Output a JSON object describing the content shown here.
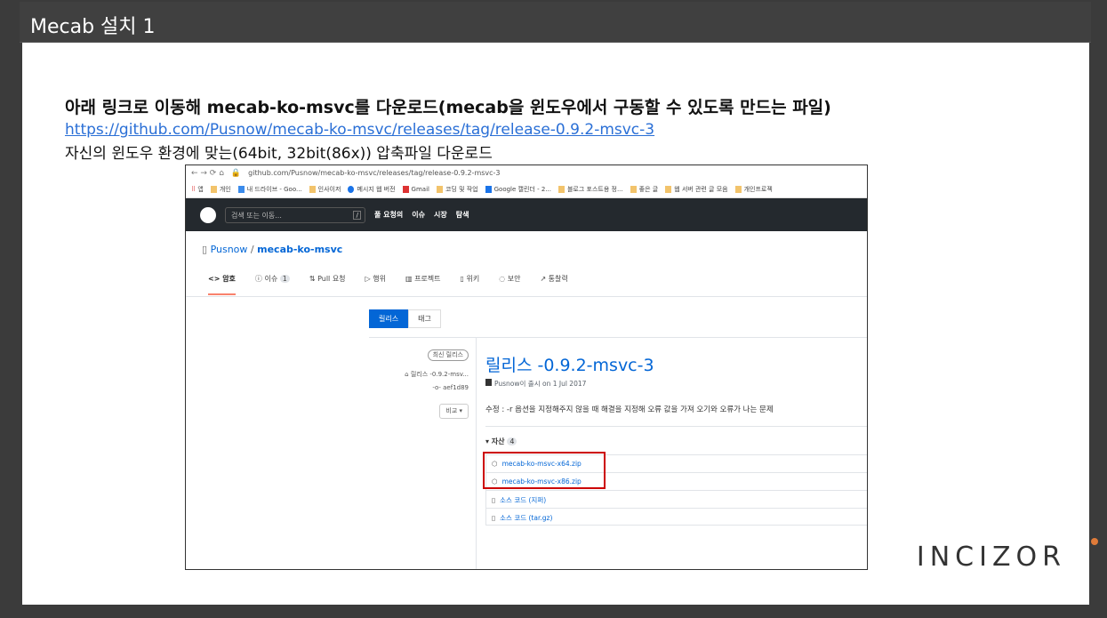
{
  "slide": {
    "title": "Mecab 설치 1",
    "heading": "아래 링크로 이동해 mecab-ko-msvc를 다운로드(mecab을 윈도우에서 구동할 수 있도록 만드는 파일)",
    "link": "https://github.com/Pusnow/mecab-ko-msvc/releases/tag/release-0.9.2-msvc-3",
    "instruction": "자신의 윈도우 환경에 맞는(64bit, 32bit(86x)) 압축파일 다운로드",
    "logo": "INCIZOR"
  },
  "browser": {
    "url": "github.com/Pusnow/mecab-ko-msvc/releases/tag/release-0.9.2-msvc-3",
    "bookmarks": [
      "앱",
      "개인",
      "내 드라이브 - Goo...",
      "인사이저",
      "메시지 웹 버전",
      "Gmail",
      "코딩 및 작업",
      "Google 캘린더 - 2...",
      "블로그 포스트용 정...",
      "좋은 글",
      "웹 서버 관련 글 모음",
      "개인프로젝"
    ]
  },
  "github": {
    "search_placeholder": "검색 또는 이동...",
    "search_key": "/",
    "nav": [
      "풀 요청의",
      "이슈",
      "시장",
      "탐색"
    ],
    "owner": "Pusnow",
    "sep": "/",
    "repo": "mecab-ko-msvc",
    "tabs": [
      "<> 암호",
      "ⓘ 이슈",
      "⇅ Pull 요청",
      "▷ 행위",
      "▥ 프로젝트",
      "▯ 위키",
      "◌ 보안",
      "↗ 통찰력"
    ],
    "issue_count": "1",
    "seg": [
      "릴리스",
      "태그"
    ],
    "latest": "최신 릴리스",
    "tag": "릴리스 -0.9.2-msv...",
    "commit": "-o- aef1d89",
    "compare": "비교 ▾",
    "release_title": "릴리스 -0.9.2-msvc-3",
    "meta": "Pusnow이 출시 on 1 Jul 2017",
    "desc": "수정 : -r 옵션을 지정해주지 않을 때 해결을 지정해 오류 값을 가져 오기와 오류가 나는 문제",
    "assets_label": "▾ 자산",
    "assets_count": "4",
    "assets": [
      "mecab-ko-msvc-x64.zip",
      "mecab-ko-msvc-x86.zip",
      "소스 코드 (지퍼)",
      "소스 코드 (tar.gz)"
    ]
  }
}
